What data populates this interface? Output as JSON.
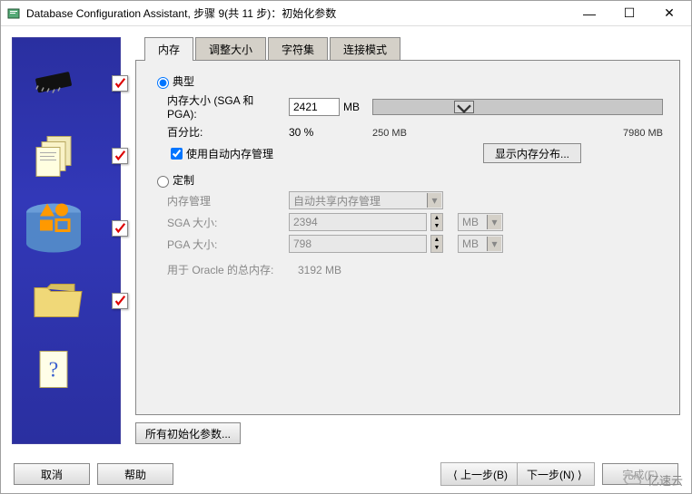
{
  "window": {
    "title": "Database Configuration Assistant, 步骤 9(共 11 步)：初始化参数"
  },
  "tabs": {
    "memory": "内存",
    "sizing": "调整大小",
    "charset": "字符集",
    "connmode": "连接模式"
  },
  "typical": {
    "radio_label": "典型",
    "mem_size_label": "内存大小 (SGA 和 PGA):",
    "mem_size_value": "2421",
    "mem_size_unit": "MB",
    "pct_label": "百分比:",
    "pct_value": "30 %",
    "slider_min": "250 MB",
    "slider_max": "7980 MB",
    "auto_mem_label": "使用自动内存管理",
    "auto_mem_checked": true,
    "show_dist_btn": "显示内存分布..."
  },
  "custom": {
    "radio_label": "定制",
    "mem_mgmt_label": "内存管理",
    "mem_mgmt_value": "自动共享内存管理",
    "sga_label": "SGA 大小:",
    "sga_value": "2394",
    "sga_unit": "MB",
    "pga_label": "PGA 大小:",
    "pga_value": "798",
    "pga_unit": "MB",
    "total_label": "用于 Oracle 的总内存:",
    "total_value": "3192 MB"
  },
  "buttons": {
    "all_params": "所有初始化参数...",
    "cancel": "取消",
    "help": "帮助",
    "back": "上一步(B)",
    "next": "下一步(N)",
    "finish": "完成(F)"
  },
  "watermark": "亿速云"
}
